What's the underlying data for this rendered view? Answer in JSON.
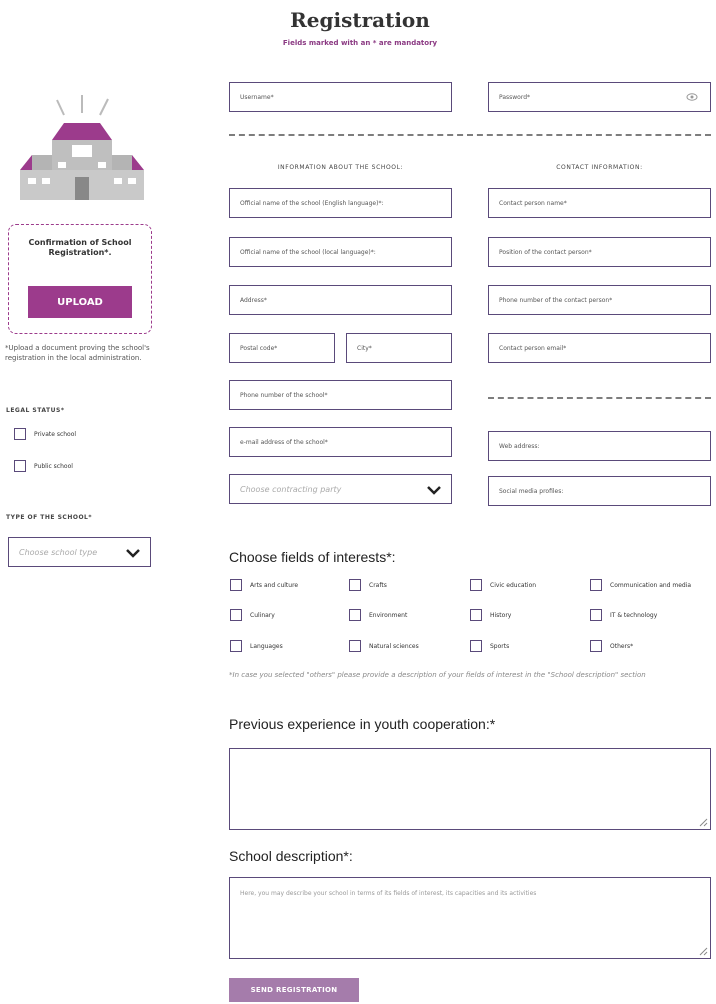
{
  "header": {
    "title": "Registration",
    "subtitle": "Fields marked with an * are mandatory"
  },
  "account": {
    "username_placeholder": "Username*",
    "password_placeholder": "Password*"
  },
  "school_info": {
    "heading": "INFORMATION ABOUT THE SCHOOL:",
    "fields": [
      "Official name of the school (English language)*:",
      "Official name of the school (local language)*:",
      "Address*",
      "Postal code*",
      "City*",
      "Phone number of the school*",
      "e-mail address of the school*"
    ],
    "contracting_party": "Choose contracting party"
  },
  "contact_info": {
    "heading": "CONTACT INFORMATION:",
    "fields": [
      "Contact person name*",
      "Position of the contact person*",
      "Phone number of the contact person*",
      "Contact person email*",
      "Web address:",
      "Social media profiles:"
    ]
  },
  "sidebar": {
    "upload_title": "Confirmation of School Registration*.",
    "upload_button": "UPLOAD",
    "upload_note": "*Upload a document proving the school's registration in the local administration.",
    "legal_status_label": "LEGAL STATUS*",
    "legal_options": [
      "Private school",
      "Public school"
    ],
    "school_type_label": "TYPE OF THE SCHOOL*",
    "school_type_placeholder": "Choose school type"
  },
  "interests": {
    "heading": "Choose fields of interests*:",
    "options": [
      "Arts and culture",
      "Crafts",
      "Civic education",
      "Communication and media",
      "Culinary",
      "Environment",
      "History",
      "IT & technology",
      "Languages",
      "Natural sciences",
      "Sports",
      "Others*"
    ],
    "note": "*In case you selected \"others\" please provide a description of your fields of interest in the \"School description\" section"
  },
  "experience": {
    "heading": "Previous experience in youth cooperation:*"
  },
  "description": {
    "heading": "School description*:",
    "placeholder": "Here, you may describe your school in terms of its fields of interest, its capacities and its activities"
  },
  "submit_label": "SEND REGISTRATION",
  "colors": {
    "accent": "#9c3b8c",
    "border": "#5a4a7a",
    "button_muted": "#a57cab"
  }
}
